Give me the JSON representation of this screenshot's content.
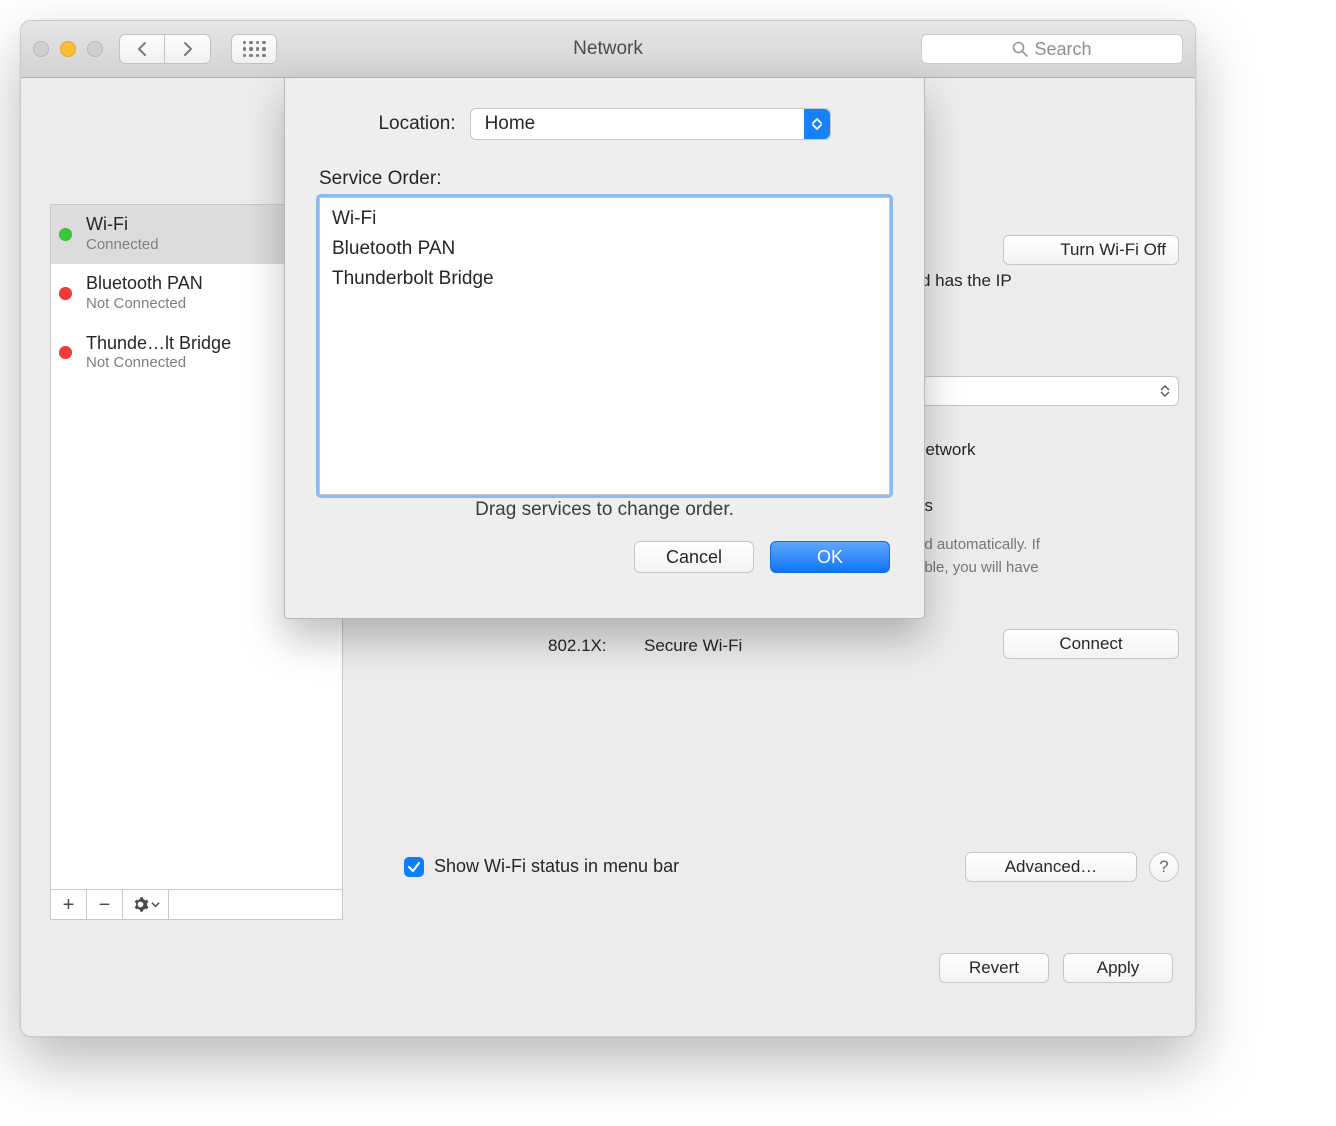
{
  "window": {
    "title": "Network",
    "search_placeholder": "Search"
  },
  "sidebar": {
    "services": [
      {
        "name": "Wi-Fi",
        "status_label": "Connected",
        "status": "green",
        "selected": true
      },
      {
        "name": "Bluetooth PAN",
        "status_label": "Not Connected",
        "status": "red",
        "selected": false
      },
      {
        "name": "Thunde…lt Bridge",
        "status_label": "Not Connected",
        "status": "red",
        "selected": false
      }
    ]
  },
  "right_pane": {
    "wifi_off_button": "Turn Wi-Fi Off",
    "ip_fragment": "d has the IP",
    "network_fragment": "network",
    "ks_fragment": "ks",
    "auto_line1": "ed automatically. If",
    "auto_line2": "able, you will have",
    "auto_line3": ".",
    "row_8021x_label": "802.1X:",
    "row_8021x_value": "Secure Wi-Fi",
    "connect_button": "Connect",
    "menubar_checkbox_label": "Show Wi-Fi status in menu bar",
    "menubar_checked": true,
    "advanced_button": "Advanced…",
    "help_button": "?",
    "revert_button": "Revert",
    "apply_button": "Apply"
  },
  "sheet": {
    "location_label": "Location:",
    "location_value": "Home",
    "service_order_label": "Service Order:",
    "services": [
      "Wi-Fi",
      "Bluetooth PAN",
      "Thunderbolt Bridge"
    ],
    "hint": "Drag services to change order.",
    "cancel": "Cancel",
    "ok": "OK"
  }
}
